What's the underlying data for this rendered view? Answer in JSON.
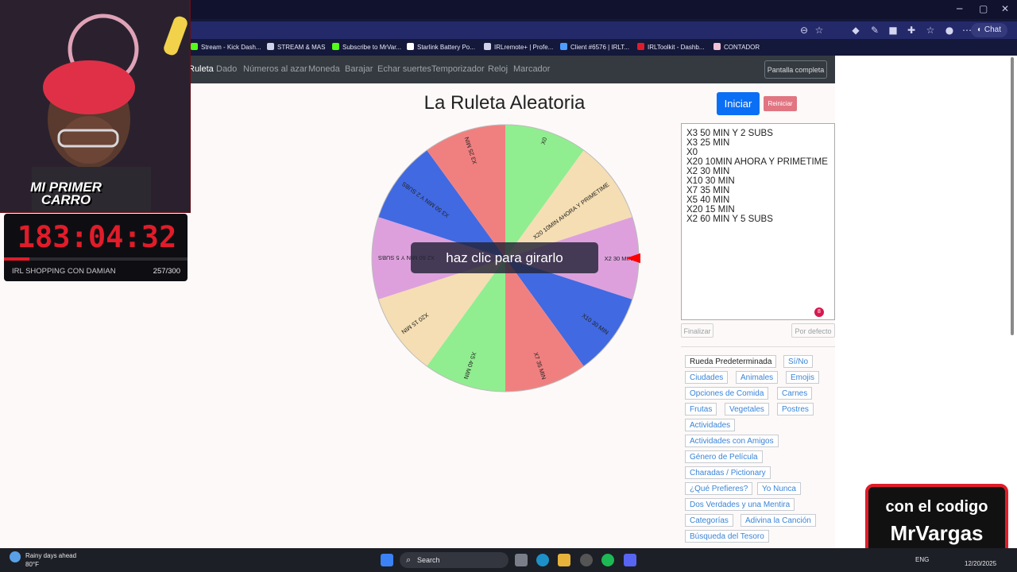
{
  "browser": {
    "bookmarks": [
      {
        "label": "Stream - Kick Dash...",
        "color": "#53fc18"
      },
      {
        "label": "STREAM & MAS",
        "color": "#cfd2e8"
      },
      {
        "label": "Subscribe to MrVar...",
        "color": "#53fc18"
      },
      {
        "label": "Starlink Battery Po...",
        "color": "#ffffff"
      },
      {
        "label": "IRLremote+ | Profe...",
        "color": "#cfd2e8"
      },
      {
        "label": "Client #6576 | IRLT...",
        "color": "#4f9cff"
      },
      {
        "label": "IRLToolkit - Dashb...",
        "color": "#e11c2a"
      },
      {
        "label": "CONTADOR",
        "color": "#f3c1d6"
      }
    ],
    "chat_label": "Chat"
  },
  "nav": {
    "links": [
      "Ruleta",
      "Dado",
      "Números al azar",
      "Moneda",
      "Barajar",
      "Echar suertes",
      "Temporizador",
      "Reloj",
      "Marcador"
    ],
    "fullscreen": "Pantalla completa"
  },
  "page": {
    "title": "La Ruleta Aleatoria",
    "start_button": "Iniciar",
    "reset_button": "Reiniciar",
    "spin_hint": "haz clic para girarlo",
    "entries": [
      "X3 50 MIN Y 2 SUBS",
      "X3 25 MIN",
      "X0",
      "X20 10MIN AHORA Y PRIMETIME",
      "X2 30 MIN",
      "X10 30 MIN",
      "X7 35 MIN",
      "X5 40 MIN",
      "X20 15 MIN",
      "X2 60 MIN Y 5 SUBS"
    ],
    "entries_badge": "8",
    "finalize_button": "Finalizar",
    "default_button": "Por defecto",
    "presets": [
      "Rueda Predeterminada",
      "Sí/No",
      "Ciudades",
      "Animales",
      "Emojis",
      "Opciones de Comida",
      "Carnes",
      "Frutas",
      "Vegetales",
      "Postres",
      "Actividades",
      "Actividades con Amigos",
      "Género de Película",
      "Charadas / Pictionary",
      "¿Qué Prefieres?",
      "Yo Nunca",
      "Dos Verdades y una Mentira",
      "Categorías",
      "Adivina la Canción",
      "Búsqueda del Tesoro"
    ]
  },
  "wheel": {
    "segments": [
      {
        "label": "X0",
        "color": "#90ee90"
      },
      {
        "label": "X20 10MIN AHORA Y PRIMETIME",
        "color": "#f5deb3"
      },
      {
        "label": "X2 30 MIN",
        "color": "#dda0dd"
      },
      {
        "label": "X10 30 MIN",
        "color": "#4169e1"
      },
      {
        "label": "X7 35 MIN",
        "color": "#f08080"
      },
      {
        "label": "X5 40 MIN",
        "color": "#90ee90"
      },
      {
        "label": "X20 15 MIN",
        "color": "#f5deb3"
      },
      {
        "label": "X2 60 MIN Y 5 SUBS",
        "color": "#dda0dd"
      },
      {
        "label": "X3 50 MIN Y 2 SUBS",
        "color": "#4169e1"
      },
      {
        "label": "X3 25 MIN",
        "color": "#f08080"
      }
    ],
    "pointer_color": "#ff0000"
  },
  "overlay": {
    "banner_line1": "MI PRIMER",
    "banner_line2": "CARRO",
    "timer": "183:04:32",
    "timer_progress": 0.14,
    "timer_caption": "IRL SHOPPING CON DAMIAN",
    "timer_count": "257/300",
    "promo_line1": "con el codigo",
    "promo_line2": "MrVargas"
  },
  "taskbar": {
    "weather_title": "Rainy days ahead",
    "weather_temp": "80°F",
    "search_label": "Search",
    "lang": "ENG",
    "date": "12/20/2025"
  }
}
